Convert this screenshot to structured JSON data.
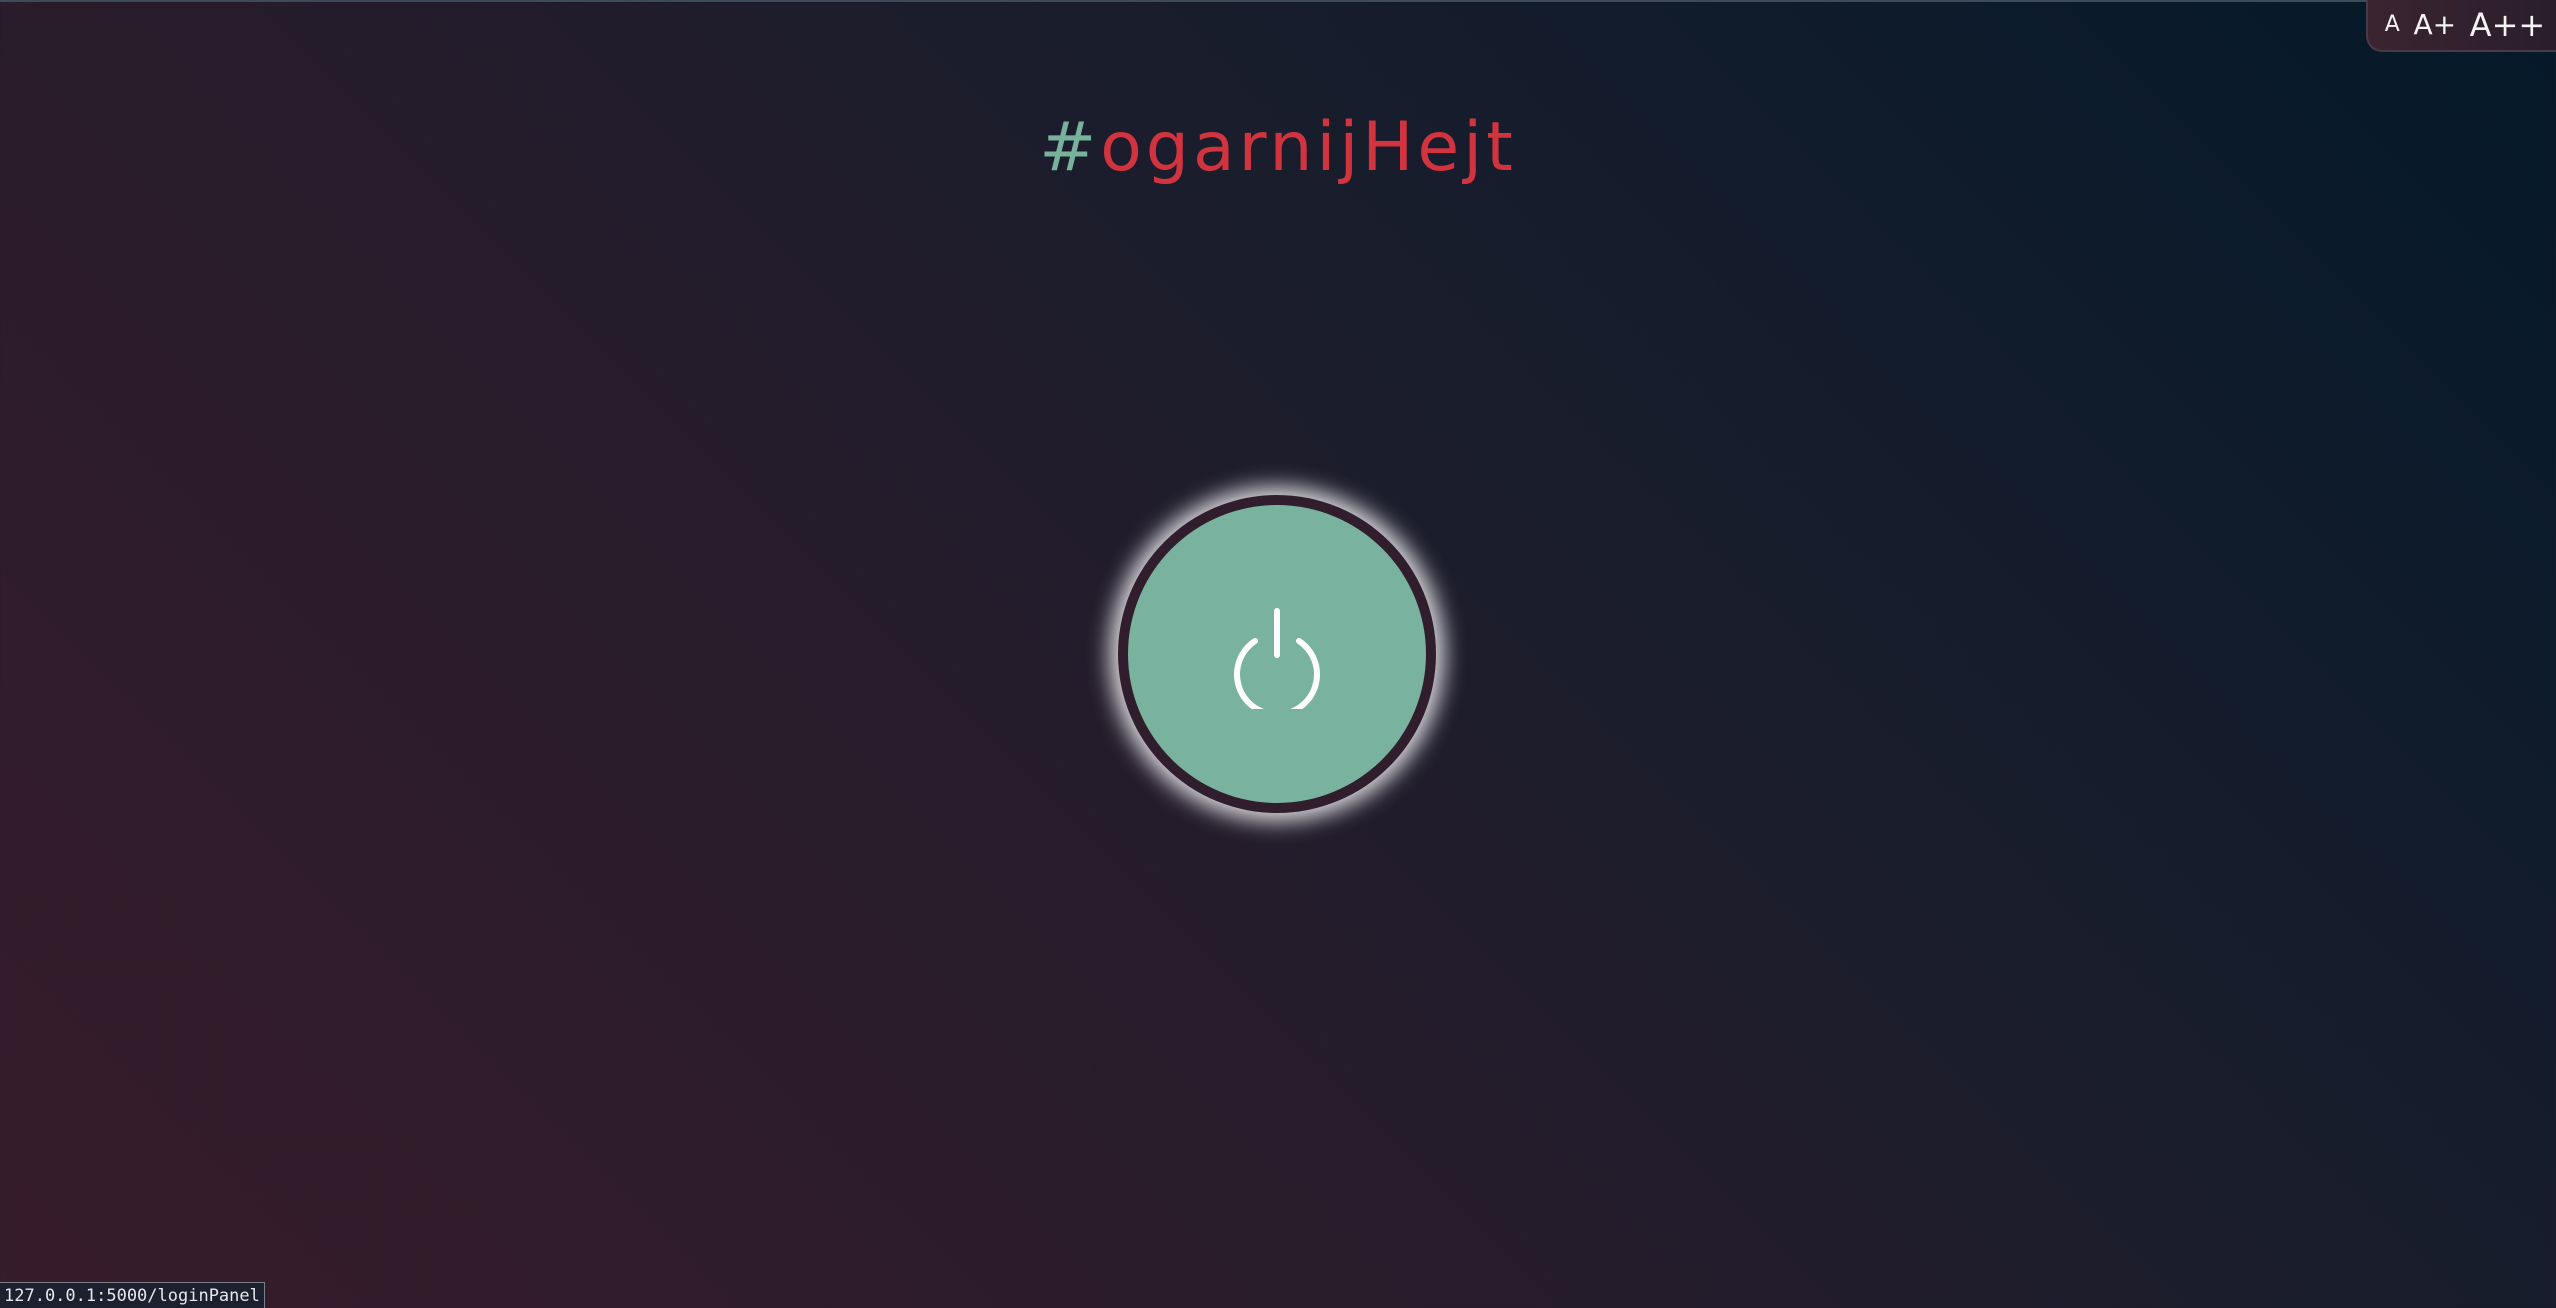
{
  "header": {
    "title_hash": "#",
    "title_word": "ogarnijHejt"
  },
  "font_size_controls": {
    "small_label": "A",
    "medium_label": "A+",
    "large_label": "A++"
  },
  "power_button": {
    "icon": "power-icon"
  },
  "status_bar": {
    "url": "127.0.0.1:5000/loginPanel"
  },
  "colors": {
    "accent_green": "#79b29f",
    "accent_red": "#d1343f",
    "button_ring": "#311e2c"
  }
}
